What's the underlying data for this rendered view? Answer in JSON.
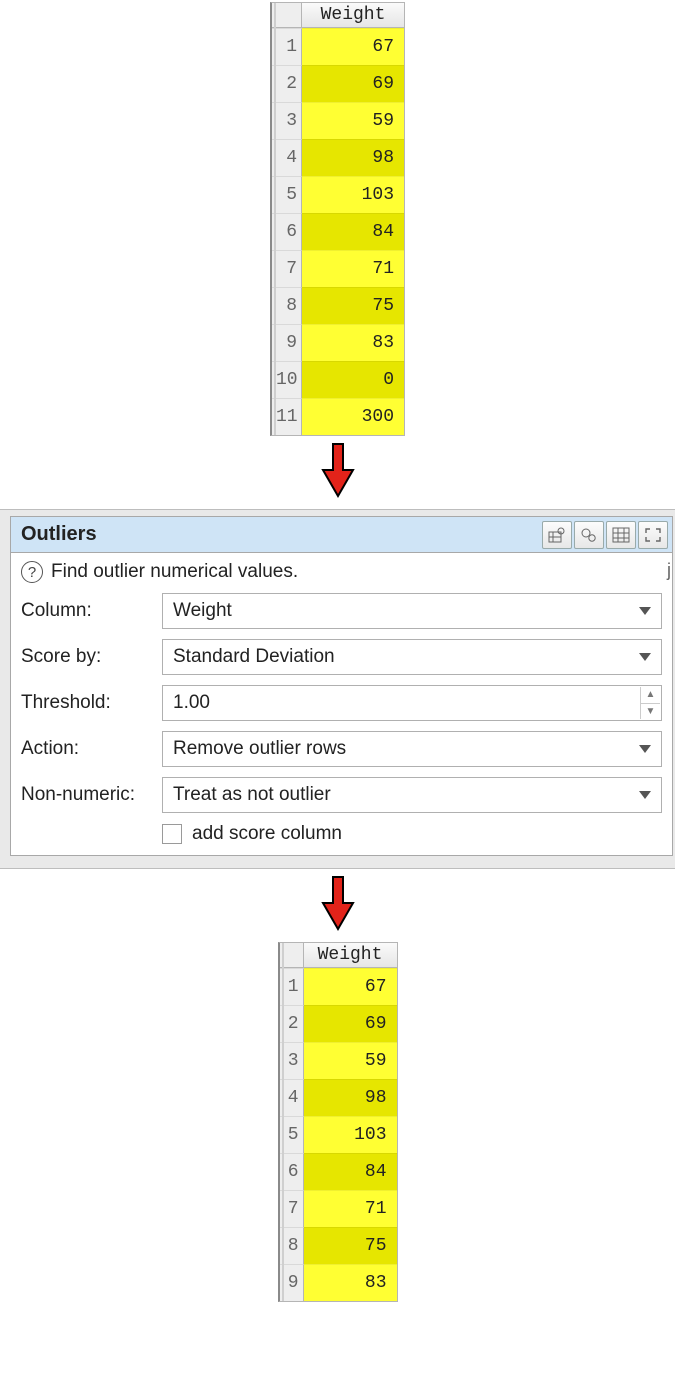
{
  "table_header": "Weight",
  "input_rows": [
    {
      "idx": "1",
      "val": "67"
    },
    {
      "idx": "2",
      "val": "69"
    },
    {
      "idx": "3",
      "val": "59"
    },
    {
      "idx": "4",
      "val": "98"
    },
    {
      "idx": "5",
      "val": "103"
    },
    {
      "idx": "6",
      "val": "84"
    },
    {
      "idx": "7",
      "val": "71"
    },
    {
      "idx": "8",
      "val": "75"
    },
    {
      "idx": "9",
      "val": "83"
    },
    {
      "idx": "10",
      "val": "0"
    },
    {
      "idx": "11",
      "val": "300"
    }
  ],
  "output_rows": [
    {
      "idx": "1",
      "val": "67"
    },
    {
      "idx": "2",
      "val": "69"
    },
    {
      "idx": "3",
      "val": "59"
    },
    {
      "idx": "4",
      "val": "98"
    },
    {
      "idx": "5",
      "val": "103"
    },
    {
      "idx": "6",
      "val": "84"
    },
    {
      "idx": "7",
      "val": "71"
    },
    {
      "idx": "8",
      "val": "75"
    },
    {
      "idx": "9",
      "val": "83"
    }
  ],
  "dialog": {
    "title": "Outliers",
    "description": "Find outlier numerical values.",
    "labels": {
      "column": "Column:",
      "score_by": "Score by:",
      "threshold": "Threshold:",
      "action": "Action:",
      "non_numeric": "Non-numeric:",
      "add_score": "add score column"
    },
    "values": {
      "column": "Weight",
      "score_by": "Standard Deviation",
      "threshold": "1.00",
      "action": "Remove outlier rows",
      "non_numeric": "Treat as not outlier"
    }
  }
}
